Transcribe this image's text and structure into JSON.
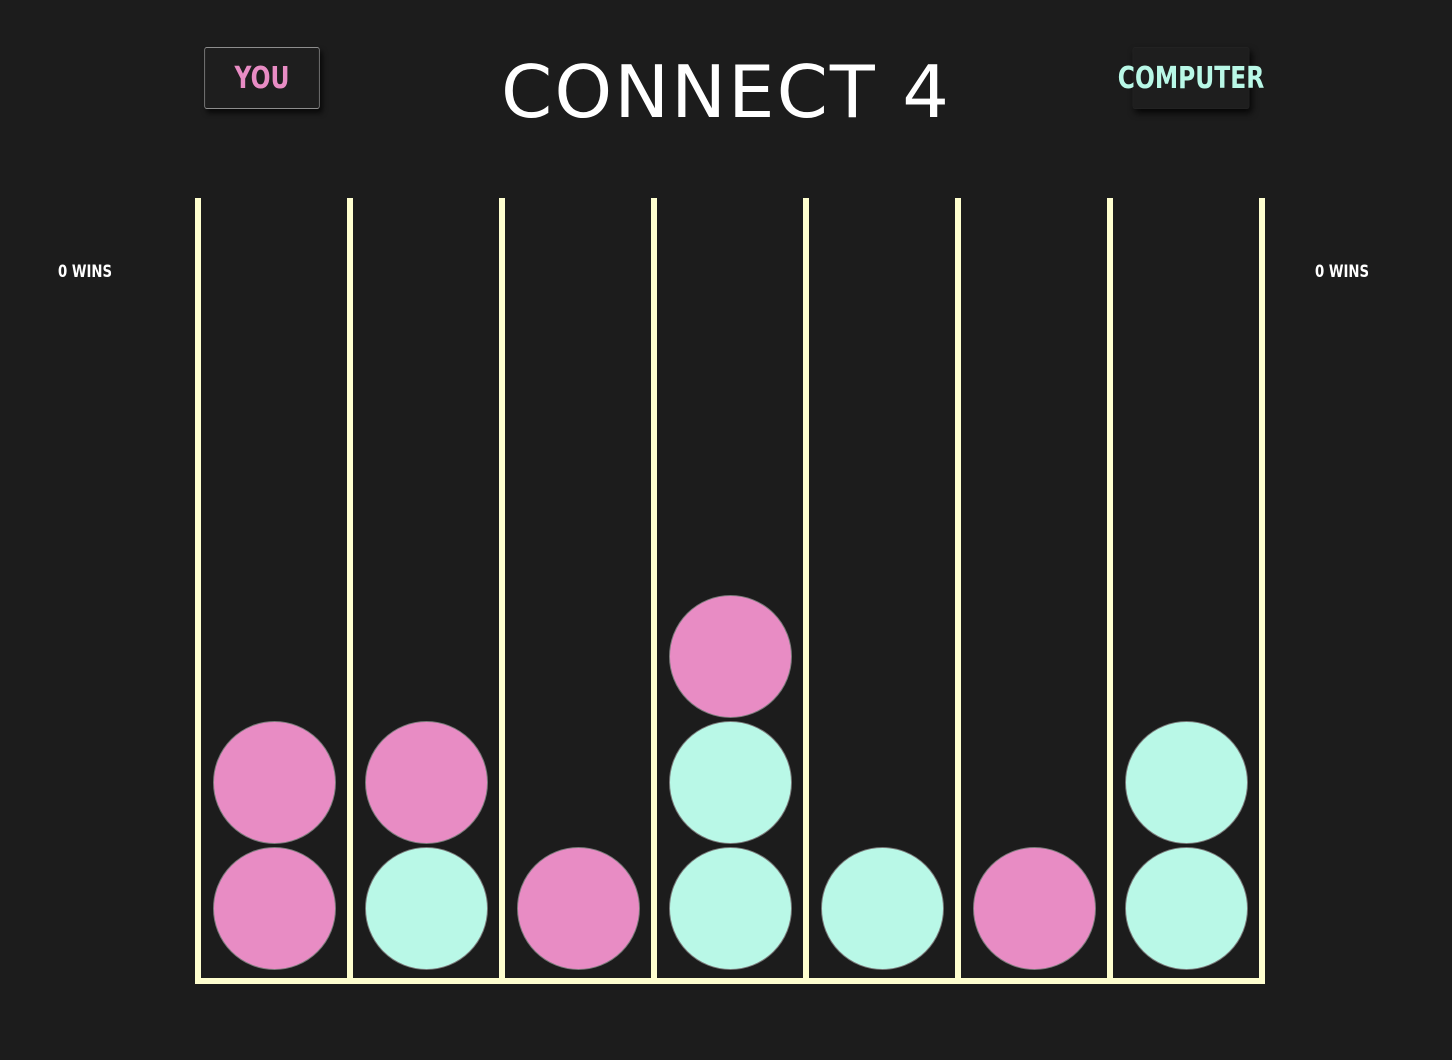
{
  "title": "CONNECT 4",
  "players": {
    "you": {
      "label": "YOU",
      "wins": "0 WINS",
      "color": "#e88cc4"
    },
    "computer": {
      "label": "COMPUTER",
      "wins": "0 WINS",
      "color": "#b9f8e7"
    }
  },
  "colors": {
    "background": "#1c1c1c",
    "frame": "#fefecf",
    "title": "#ffffff"
  },
  "board": {
    "columns": 7,
    "rows": 6,
    "stacks": [
      [
        "you",
        "you"
      ],
      [
        "computer",
        "you"
      ],
      [
        "you"
      ],
      [
        "computer",
        "computer",
        "you"
      ],
      [
        "computer"
      ],
      [
        "you"
      ],
      [
        "computer",
        "computer"
      ]
    ]
  }
}
